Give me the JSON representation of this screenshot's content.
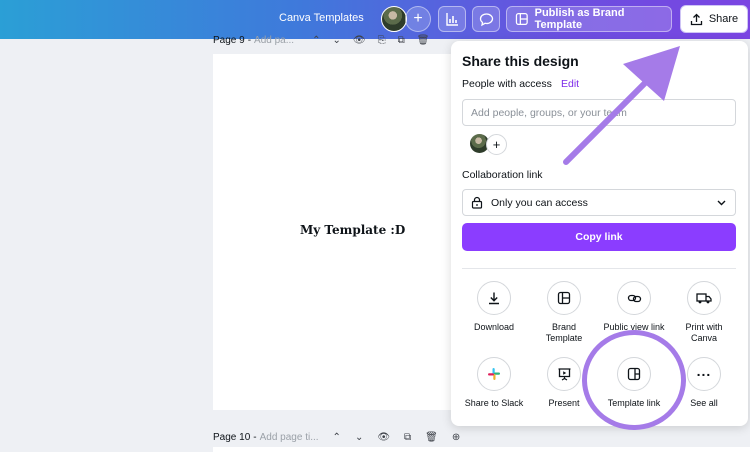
{
  "topbar": {
    "title": "Canva Templates",
    "publish_label": "Publish as Brand Template",
    "share_label": "Share"
  },
  "pages": {
    "page9": {
      "label": "Page 9",
      "placeholder": "Add pa..."
    },
    "page10": {
      "label": "Page 10",
      "placeholder": "Add page ti..."
    }
  },
  "canvas": {
    "text": "My Template :D"
  },
  "share_panel": {
    "title": "Share this design",
    "people_label": "People with access",
    "edit_label": "Edit",
    "input_placeholder": "Add people, groups, or your team",
    "collab_label": "Collaboration link",
    "access_value": "Only you can access",
    "copy_label": "Copy link",
    "options": [
      {
        "label": "Download",
        "icon": "download-icon"
      },
      {
        "label": "Brand Template",
        "icon": "brand-template-icon"
      },
      {
        "label": "Public view link",
        "icon": "link-icon"
      },
      {
        "label": "Print with Canva",
        "icon": "truck-icon"
      },
      {
        "label": "Share to Slack",
        "icon": "slack-icon"
      },
      {
        "label": "Present",
        "icon": "present-icon"
      },
      {
        "label": "Template link",
        "icon": "template-link-icon"
      },
      {
        "label": "See all",
        "icon": "more-icon"
      }
    ]
  },
  "colors": {
    "accent": "#8b3dff",
    "annotation": "#a57be8"
  }
}
